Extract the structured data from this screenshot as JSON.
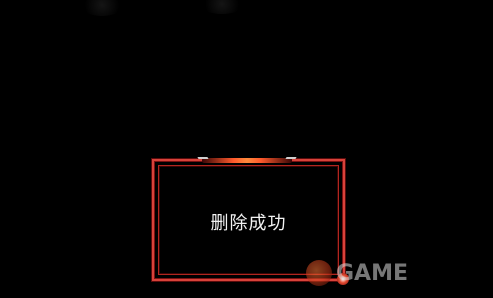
{
  "dialog": {
    "message": "删除成功"
  },
  "watermark": {
    "text": "GAME"
  },
  "colors": {
    "background": "#000000",
    "frame_red": "#d8423a",
    "accent_orange": "#ff8a3c",
    "text": "#f2f2f2"
  }
}
